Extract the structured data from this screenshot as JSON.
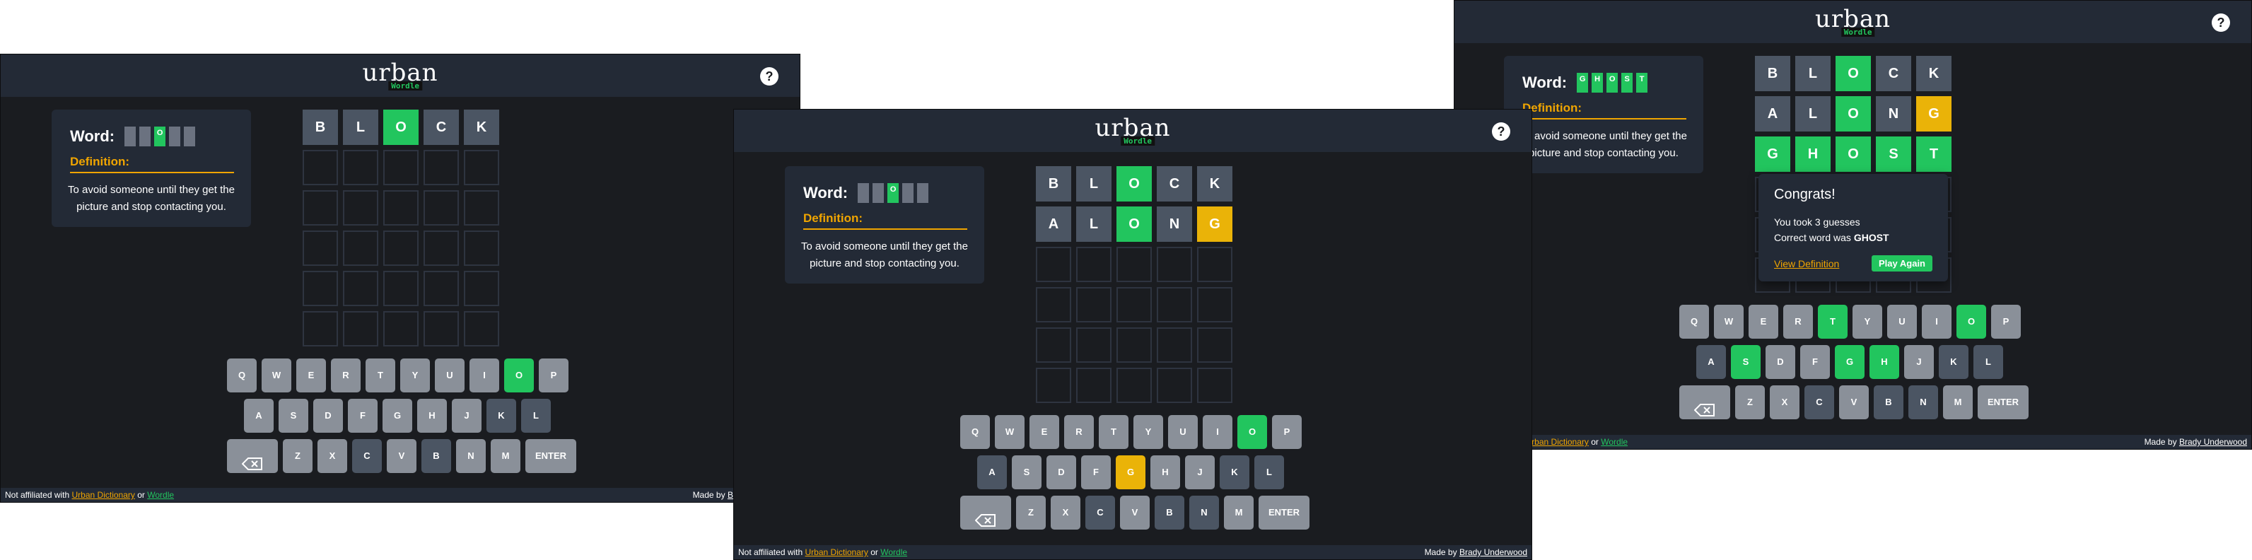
{
  "app": {
    "logo_text": "urban",
    "logo_sub": "Wordle",
    "help_label": "?"
  },
  "word_panel": {
    "word_label": "Word:",
    "definition_label": "Definition:",
    "definition_text": "To avoid someone until they get the picture and stop contacting you."
  },
  "footer": {
    "not_affiliated": "Not affiliated with",
    "urban_dictionary": "Urban Dictionary",
    "or": "or",
    "wordle": "Wordle",
    "made_by": "Made by",
    "author": "Brady Underwood"
  },
  "keyboard": {
    "rows": [
      [
        "Q",
        "W",
        "E",
        "R",
        "T",
        "Y",
        "U",
        "I",
        "O",
        "P"
      ],
      [
        "A",
        "S",
        "D",
        "F",
        "G",
        "H",
        "J",
        "K",
        "L"
      ],
      [
        "BACKSPACE",
        "Z",
        "X",
        "C",
        "V",
        "B",
        "N",
        "M",
        "ENTER"
      ]
    ],
    "enter_label": "ENTER"
  },
  "screens": [
    {
      "word_mask": [
        [
          "",
          ""
        ],
        [
          "",
          ""
        ],
        [
          "O",
          "g"
        ],
        [
          "",
          ""
        ],
        [
          "",
          ""
        ]
      ],
      "board": [
        [
          [
            "B",
            "f"
          ],
          [
            "L",
            "f"
          ],
          [
            "O",
            "g"
          ],
          [
            "C",
            "f"
          ],
          [
            "K",
            "f"
          ]
        ],
        [
          [
            "",
            ""
          ],
          [
            "",
            ""
          ],
          [
            "",
            ""
          ],
          [
            "",
            ""
          ],
          [
            "",
            ""
          ]
        ],
        [
          [
            "",
            ""
          ],
          [
            "",
            ""
          ],
          [
            "",
            ""
          ],
          [
            "",
            ""
          ],
          [
            "",
            ""
          ]
        ],
        [
          [
            "",
            ""
          ],
          [
            "",
            ""
          ],
          [
            "",
            ""
          ],
          [
            "",
            ""
          ],
          [
            "",
            ""
          ]
        ],
        [
          [
            "",
            ""
          ],
          [
            "",
            ""
          ],
          [
            "",
            ""
          ],
          [
            "",
            ""
          ],
          [
            "",
            ""
          ]
        ],
        [
          [
            "",
            ""
          ],
          [
            "",
            ""
          ],
          [
            "",
            ""
          ],
          [
            "",
            ""
          ],
          [
            "",
            ""
          ]
        ]
      ],
      "key_states": {
        "O": "g",
        "B": "x",
        "L": "x",
        "C": "x",
        "K": "x"
      }
    },
    {
      "word_mask": [
        [
          "",
          ""
        ],
        [
          "",
          ""
        ],
        [
          "O",
          "g"
        ],
        [
          "",
          ""
        ],
        [
          "",
          ""
        ]
      ],
      "board": [
        [
          [
            "B",
            "f"
          ],
          [
            "L",
            "f"
          ],
          [
            "O",
            "g"
          ],
          [
            "C",
            "f"
          ],
          [
            "K",
            "f"
          ]
        ],
        [
          [
            "A",
            "f"
          ],
          [
            "L",
            "f"
          ],
          [
            "O",
            "g"
          ],
          [
            "N",
            "f"
          ],
          [
            "G",
            "y"
          ]
        ],
        [
          [
            "",
            ""
          ],
          [
            "",
            ""
          ],
          [
            "",
            ""
          ],
          [
            "",
            ""
          ],
          [
            "",
            ""
          ]
        ],
        [
          [
            "",
            ""
          ],
          [
            "",
            ""
          ],
          [
            "",
            ""
          ],
          [
            "",
            ""
          ],
          [
            "",
            ""
          ]
        ],
        [
          [
            "",
            ""
          ],
          [
            "",
            ""
          ],
          [
            "",
            ""
          ],
          [
            "",
            ""
          ],
          [
            "",
            ""
          ]
        ],
        [
          [
            "",
            ""
          ],
          [
            "",
            ""
          ],
          [
            "",
            ""
          ],
          [
            "",
            ""
          ],
          [
            "",
            ""
          ]
        ]
      ],
      "key_states": {
        "O": "g",
        "G": "y",
        "B": "x",
        "L": "x",
        "C": "x",
        "K": "x",
        "A": "x",
        "N": "x"
      }
    },
    {
      "word_mask": [
        [
          "G",
          "g"
        ],
        [
          "H",
          "g"
        ],
        [
          "O",
          "g"
        ],
        [
          "S",
          "g"
        ],
        [
          "T",
          "g"
        ]
      ],
      "board": [
        [
          [
            "B",
            "f"
          ],
          [
            "L",
            "f"
          ],
          [
            "O",
            "g"
          ],
          [
            "C",
            "f"
          ],
          [
            "K",
            "f"
          ]
        ],
        [
          [
            "A",
            "f"
          ],
          [
            "L",
            "f"
          ],
          [
            "O",
            "g"
          ],
          [
            "N",
            "f"
          ],
          [
            "G",
            "y"
          ]
        ],
        [
          [
            "G",
            "g"
          ],
          [
            "H",
            "g"
          ],
          [
            "O",
            "g"
          ],
          [
            "S",
            "g"
          ],
          [
            "T",
            "g"
          ]
        ],
        [
          [
            "",
            ""
          ],
          [
            "",
            ""
          ],
          [
            "",
            ""
          ],
          [
            "",
            ""
          ],
          [
            "",
            ""
          ]
        ],
        [
          [
            "",
            ""
          ],
          [
            "",
            ""
          ],
          [
            "",
            ""
          ],
          [
            "",
            ""
          ],
          [
            "",
            ""
          ]
        ],
        [
          [
            "",
            ""
          ],
          [
            "",
            ""
          ],
          [
            "",
            ""
          ],
          [
            "",
            ""
          ],
          [
            "",
            ""
          ]
        ]
      ],
      "key_states": {
        "O": "g",
        "T": "g",
        "S": "g",
        "G": "g",
        "H": "g",
        "B": "x",
        "L": "x",
        "C": "x",
        "K": "x",
        "A": "x",
        "N": "x"
      }
    }
  ],
  "modal": {
    "title": "Congrats!",
    "guesses": "You took 3 guesses",
    "correct_prefix": "Correct word was ",
    "correct_word": "GHOST",
    "view_definition": "View Definition",
    "play_again": "Play Again"
  }
}
